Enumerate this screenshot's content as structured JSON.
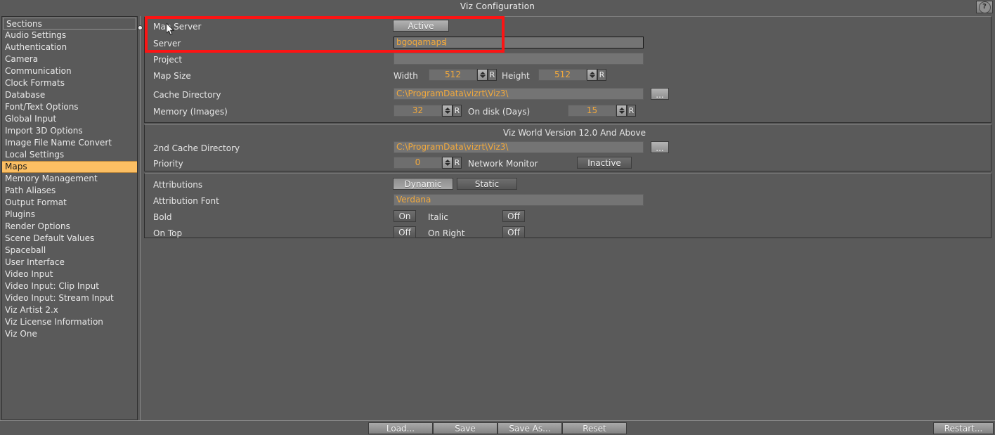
{
  "window": {
    "title": "Viz Configuration",
    "help_icon": "question-mark-icon",
    "help_label": "?"
  },
  "sidebar": {
    "header": "Sections",
    "selected": "Maps",
    "items": [
      "Audio Settings",
      "Authentication",
      "Camera",
      "Communication",
      "Clock Formats",
      "Database",
      "Font/Text Options",
      "Global Input",
      "Import 3D Options",
      "Image File Name Convert",
      "Local Settings",
      "Maps",
      "Memory Management",
      "Path Aliases",
      "Output Format",
      "Plugins",
      "Render Options",
      "Scene Default Values",
      "Spaceball",
      "User Interface",
      "Video Input",
      "Video Input: Clip Input",
      "Video Input: Stream Input",
      "Viz Artist 2.x",
      "Viz License Information",
      "Viz One"
    ]
  },
  "main": {
    "group_server": {
      "map_server_label": "Map Server",
      "map_server_value": "Active",
      "server_label": "Server",
      "server_value": "bgoqamaps",
      "project_label": "Project",
      "project_value": "",
      "map_size_label": "Map Size",
      "width_label": "Width",
      "width_value": "512",
      "height_label": "Height",
      "height_value": "512",
      "reset_label": "R",
      "cache_dir_label": "Cache Directory",
      "cache_dir_value": "C:\\ProgramData\\vizrt\\Viz3\\",
      "browse_label": "...",
      "memory_label": "Memory (Images)",
      "memory_value": "32",
      "on_disk_label": "On disk (Days)",
      "on_disk_value": "15"
    },
    "group_second_cache": {
      "note": "Viz World Version 12.0 And Above",
      "second_cache_label": "2nd Cache Directory",
      "second_cache_value": "C:\\ProgramData\\vizrt\\Viz3\\",
      "browse_label": "...",
      "priority_label": "Priority",
      "priority_value": "0",
      "reset_label": "R",
      "network_monitor_label": "Network Monitor",
      "network_monitor_value": "Inactive"
    },
    "group_attributions": {
      "attributions_label": "Attributions",
      "attributions_dynamic": "Dynamic",
      "attributions_static": "Static",
      "attribution_font_label": "Attribution Font",
      "attribution_font_value": "Verdana",
      "bold_label": "Bold",
      "bold_value": "On",
      "italic_label": "Italic",
      "italic_value": "Off",
      "on_top_label": "On Top",
      "on_top_value": "Off",
      "on_right_label": "On Right",
      "on_right_value": "Off"
    }
  },
  "footer": {
    "load": "Load...",
    "save": "Save",
    "save_as": "Save As...",
    "reset": "Reset",
    "restart": "Restart..."
  },
  "colors": {
    "background": "#5a5a5a",
    "accent_value_text": "#f2a93c",
    "selection": "#fcbf63",
    "highlight_box": "#fc1414"
  }
}
